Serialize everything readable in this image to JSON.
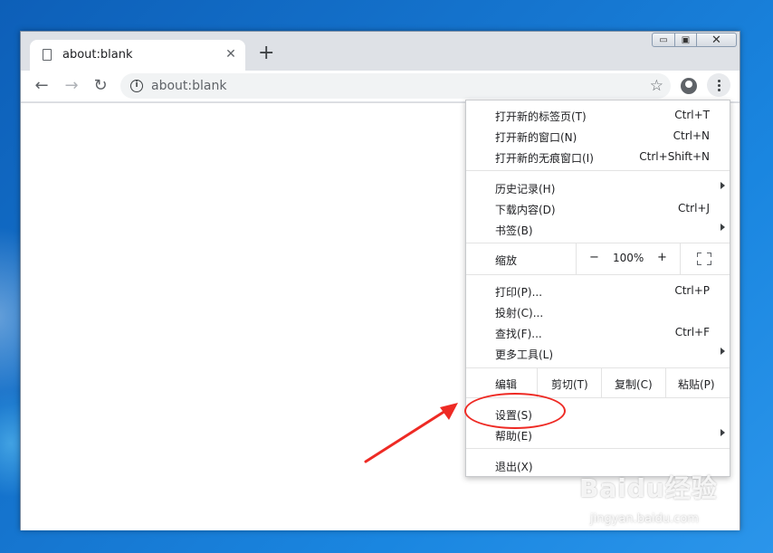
{
  "tab": {
    "title": "about:blank",
    "close": "✕",
    "new_tab": "+"
  },
  "window_controls": {
    "minimize": "▭",
    "maximize": "▣",
    "close": "✕"
  },
  "toolbar": {
    "back": "←",
    "forward": "→",
    "reload": "↻",
    "info": "i",
    "url": "about:blank",
    "star": "☆"
  },
  "menu": {
    "items": [
      {
        "label": "打开新的标签页(T)",
        "shortcut": "Ctrl+T"
      },
      {
        "label": "打开新的窗口(N)",
        "shortcut": "Ctrl+N"
      },
      {
        "label": "打开新的无痕窗口(I)",
        "shortcut": "Ctrl+Shift+N"
      },
      {
        "label": "历史记录(H)",
        "shortcut": ""
      },
      {
        "label": "下载内容(D)",
        "shortcut": "Ctrl+J"
      },
      {
        "label": "书签(B)",
        "shortcut": ""
      },
      {
        "label": "打印(P)...",
        "shortcut": "Ctrl+P"
      },
      {
        "label": "投射(C)...",
        "shortcut": ""
      },
      {
        "label": "查找(F)...",
        "shortcut": "Ctrl+F"
      },
      {
        "label": "更多工具(L)",
        "shortcut": ""
      },
      {
        "label": "设置(S)",
        "shortcut": ""
      },
      {
        "label": "帮助(E)",
        "shortcut": ""
      },
      {
        "label": "退出(X)",
        "shortcut": ""
      }
    ],
    "zoom": {
      "label": "缩放",
      "minus": "−",
      "value": "100%",
      "plus": "+"
    },
    "edit": {
      "label": "编辑",
      "cut": "剪切(T)",
      "copy": "复制(C)",
      "paste": "粘贴(P)"
    }
  },
  "annotation": {
    "color": "#ee2a24"
  },
  "watermark": {
    "logo": "Baidu经验",
    "sub": "jingyan.baidu.com"
  },
  "colors": {
    "desktop": "#1677d1",
    "chrome_frame": "#dee1e6",
    "omnibox": "#f1f3f4"
  }
}
